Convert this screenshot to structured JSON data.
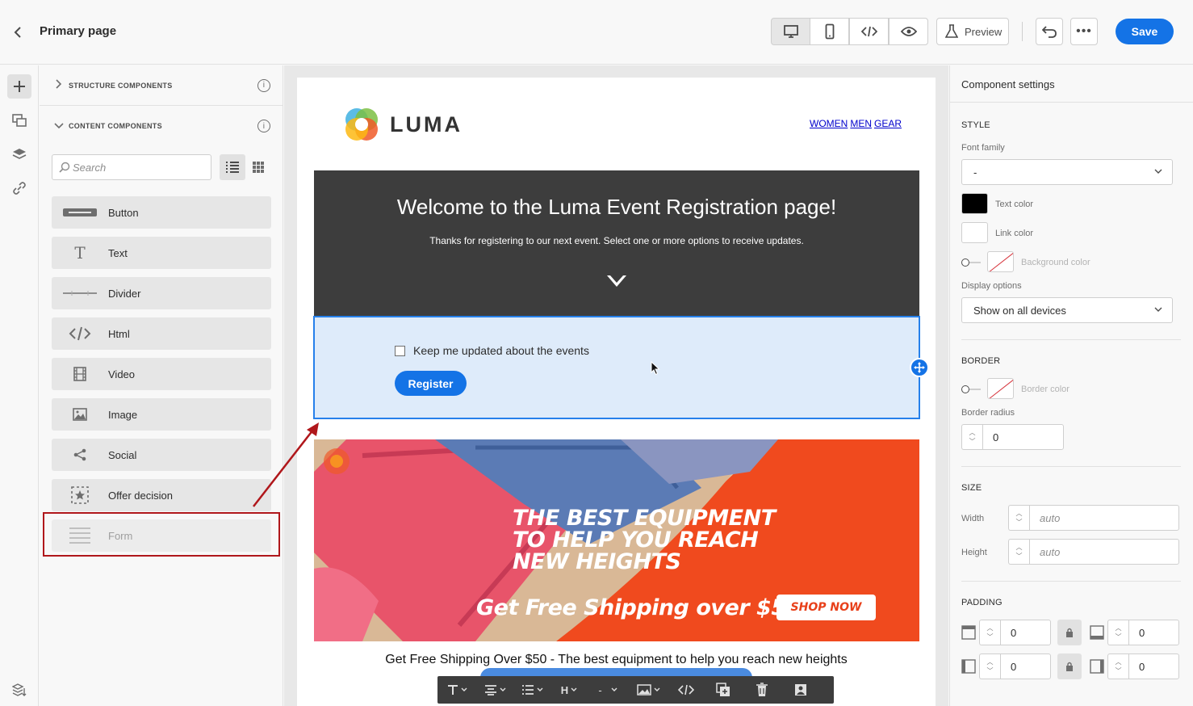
{
  "header": {
    "page_title": "Primary page",
    "preview_label": "Preview",
    "save_label": "Save"
  },
  "left_panel": {
    "structure_heading": "STRUCTURE COMPONENTS",
    "content_heading": "CONTENT COMPONENTS",
    "search_placeholder": "Search",
    "components": [
      {
        "label": "Button",
        "icon": "button-icon"
      },
      {
        "label": "Text",
        "icon": "text-icon"
      },
      {
        "label": "Divider",
        "icon": "divider-icon"
      },
      {
        "label": "Html",
        "icon": "html-icon"
      },
      {
        "label": "Video",
        "icon": "video-icon"
      },
      {
        "label": "Image",
        "icon": "image-icon"
      },
      {
        "label": "Social",
        "icon": "share-icon"
      },
      {
        "label": "Offer decision",
        "icon": "offer-decision-icon"
      },
      {
        "label": "Form",
        "icon": "form-icon"
      }
    ]
  },
  "email": {
    "brand": "LUMA",
    "nav_links": [
      "WOMEN",
      "MEN",
      "GEAR"
    ],
    "hero_title": "Welcome to the Luma Event Registration page!",
    "hero_subtitle": "Thanks for registering to our next event. Select one or more options to receive updates.",
    "checkbox_label": "Keep me updated about the events",
    "register_label": "Register",
    "banner_headline": "THE BEST EQUIPMENT\nTO HELP YOU REACH\nNEW HEIGHTS",
    "banner_shipping": "Get Free Shipping over $50",
    "banner_cta": "SHOP NOW",
    "caption": "Get Free Shipping Over $50 - The best equipment to help you reach new heights"
  },
  "toolbar": {
    "heading_label": "H",
    "size_label": "-"
  },
  "right_panel": {
    "title": "Component settings",
    "style_heading": "STYLE",
    "font_family_label": "Font family",
    "font_family_value": "-",
    "text_color_label": "Text color",
    "text_color": "#000000",
    "link_color_label": "Link color",
    "link_color": "#ffffff",
    "background_color_label": "Background color",
    "display_options_label": "Display options",
    "display_options_value": "Show on all devices",
    "border_heading": "BORDER",
    "border_color_label": "Border color",
    "border_radius_label": "Border radius",
    "border_radius_value": "0",
    "size_heading": "SIZE",
    "width_label": "Width",
    "width_placeholder": "auto",
    "height_label": "Height",
    "height_placeholder": "auto",
    "padding_heading": "PADDING",
    "padding_top": "0",
    "padding_bottom": "0",
    "padding_left": "0",
    "padding_right": "0"
  },
  "colors": {
    "accent": "#1473e6",
    "selection_border": "#2680eb",
    "selection_fill": "#deebfa",
    "annotation": "#b0171b",
    "hero_bg": "#3d3d3d",
    "banner_orange": "#f04a1e"
  }
}
